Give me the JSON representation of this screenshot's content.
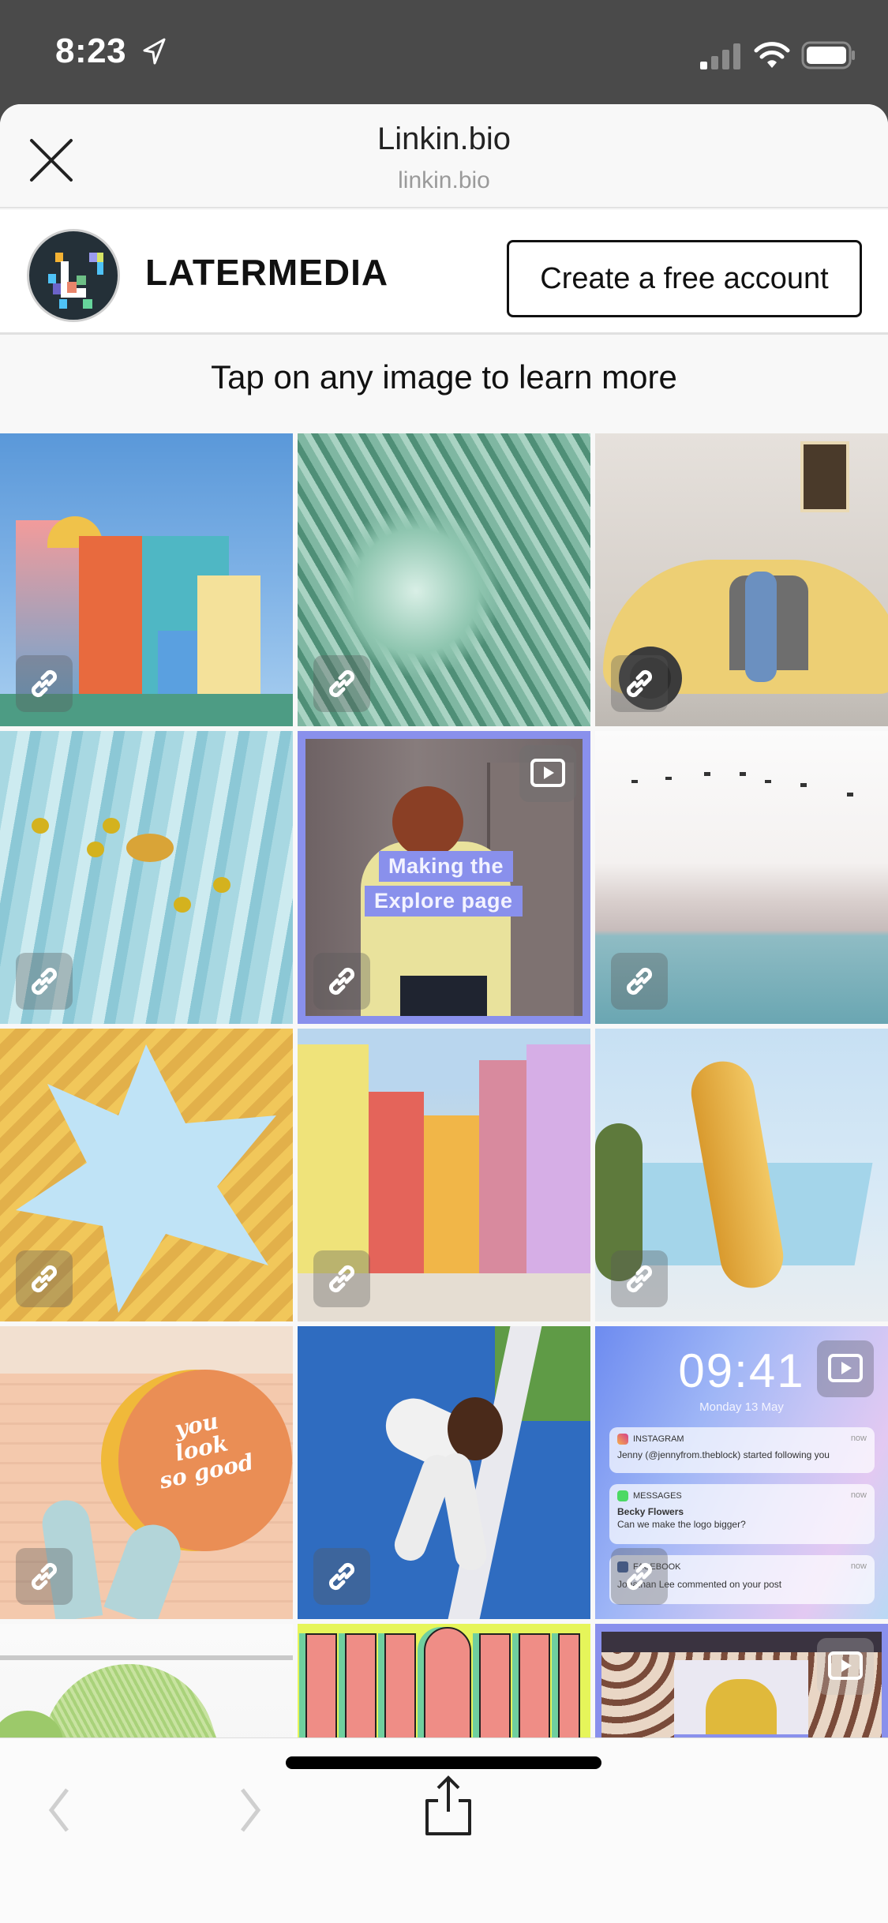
{
  "status_bar": {
    "time": "8:23",
    "location_icon": "location-arrow-icon",
    "signal_icon": "cellular-signal-icon",
    "wifi_icon": "wifi-icon",
    "battery_icon": "battery-icon"
  },
  "browser_header": {
    "title": "Linkin.bio",
    "url": "linkin.bio",
    "close_icon": "close-icon"
  },
  "profile": {
    "name": "LATERMEDIA",
    "cta_label": "Create a free account"
  },
  "hint": "Tap on any image to learn more",
  "grid": {
    "tiles": [
      {
        "subject": "Colorful apartment building against blue sky",
        "badge": "link"
      },
      {
        "subject": "Green palm leaves",
        "badge": "link"
      },
      {
        "subject": "Woman sitting in yellow vintage car",
        "badge": "link"
      },
      {
        "subject": "Pineapple and lemons floating in pool",
        "badge": "link"
      },
      {
        "subject": "Woman dancing with raised arms",
        "badge": "link",
        "video": true,
        "overlay_lines": [
          "Making the",
          "Explore page"
        ]
      },
      {
        "subject": "Birds over hazy mountains and sea",
        "badge": "link"
      },
      {
        "subject": "Yellow cube houses star-shaped sky",
        "badge": "link"
      },
      {
        "subject": "Colorful street houses",
        "badge": "link"
      },
      {
        "subject": "Giant banana peel sculpture",
        "badge": "link"
      },
      {
        "subject": "Mural on brick wall",
        "badge": "link",
        "mural_text": [
          "you",
          "look",
          "so good"
        ]
      },
      {
        "subject": "Woman stretching on blue floor",
        "badge": "link"
      },
      {
        "subject": "iPhone lock screen notifications",
        "badge": "link",
        "video": true,
        "lockscreen": {
          "time": "09:41",
          "date": "Monday 13 May",
          "notifications": [
            {
              "app": "INSTAGRAM",
              "when": "now",
              "title": "",
              "body": "Jenny (@jennyfrom.theblock) started following you"
            },
            {
              "app": "MESSAGES",
              "when": "now",
              "title": "Becky Flowers",
              "body": "Can we make the logo bigger?"
            },
            {
              "app": "FACEBOOK",
              "when": "now",
              "title": "",
              "body": "Jonathan Lee commented on your post"
            }
          ]
        }
      },
      {
        "subject": "Pale green fan palm leaf",
        "badge": "none"
      },
      {
        "subject": "Pink and green block lettering on yellow",
        "badge": "none"
      },
      {
        "subject": "Leopard print fashion video",
        "badge": "none",
        "video": true
      }
    ]
  },
  "toolbar": {
    "back_icon": "chevron-left-icon",
    "forward_icon": "chevron-right-icon",
    "share_icon": "share-icon"
  },
  "colors": {
    "status_bg": "#4a4a4a",
    "sheet_bg": "#f8f8f8",
    "accent_purple": "#8990ec",
    "avatar_bg": "#243038"
  }
}
